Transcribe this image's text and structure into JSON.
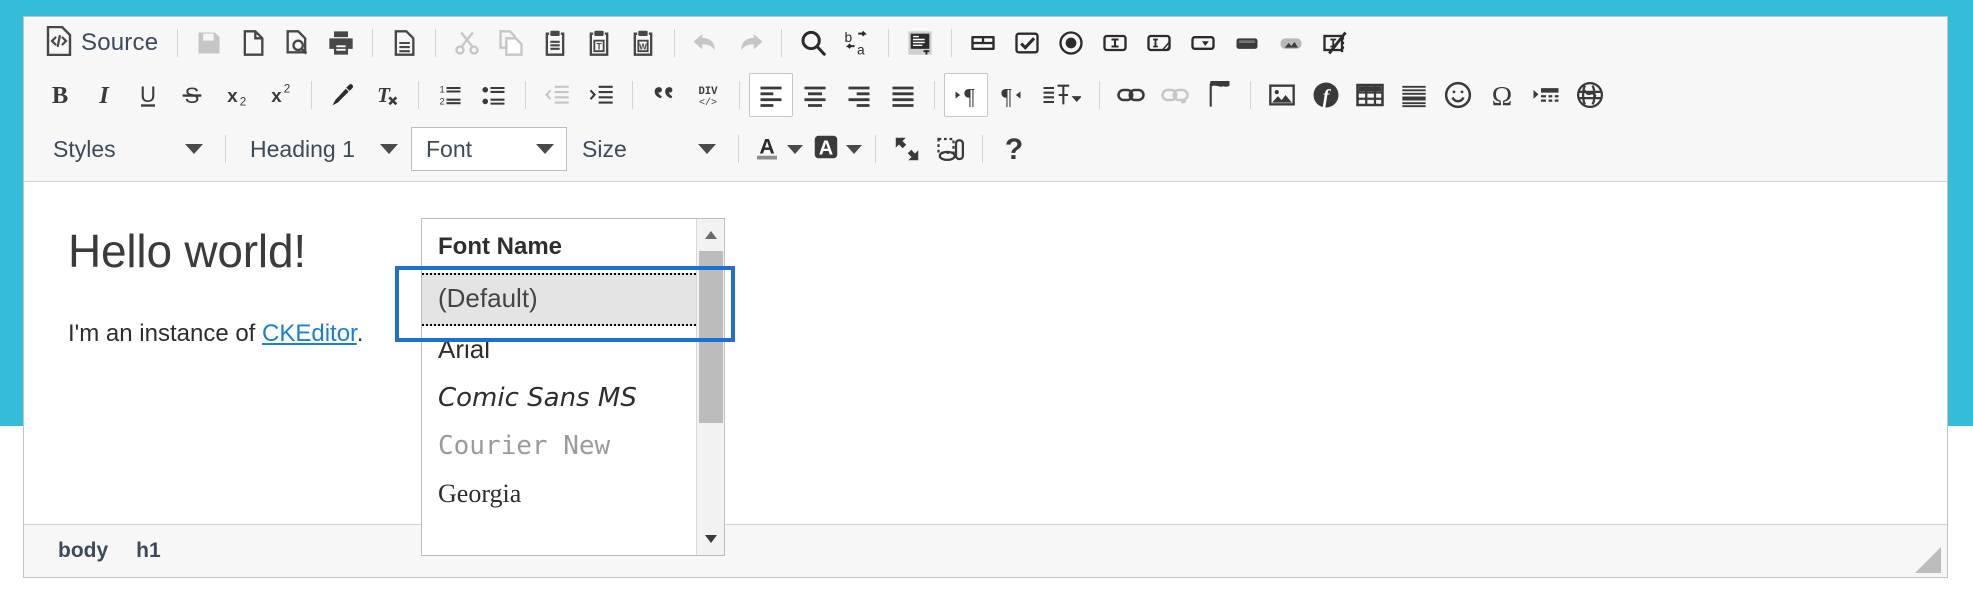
{
  "theme": {
    "page_background": "#35bcd8",
    "toolbar_background": "#f7f7f7",
    "accent_link": "#1d7fd0",
    "focus_ring": "#1f6fd0",
    "icon_color": "#474747",
    "icon_disabled": "#c6c6c6"
  },
  "toolbar": {
    "source_label": "Source",
    "row1": [
      {
        "name": "source-button",
        "label": "Source",
        "state": "enabled"
      },
      {
        "name": "separator",
        "label": "",
        "state": "separator"
      },
      {
        "name": "save-icon",
        "label": "Save",
        "state": "disabled"
      },
      {
        "name": "new-page-icon",
        "label": "New Page",
        "state": "enabled"
      },
      {
        "name": "preview-icon",
        "label": "Preview",
        "state": "enabled"
      },
      {
        "name": "print-icon",
        "label": "Print",
        "state": "enabled"
      },
      {
        "name": "separator",
        "label": "",
        "state": "separator"
      },
      {
        "name": "templates-icon",
        "label": "Templates",
        "state": "enabled"
      },
      {
        "name": "separator",
        "label": "",
        "state": "separator"
      },
      {
        "name": "cut-icon",
        "label": "Cut",
        "state": "disabled"
      },
      {
        "name": "copy-icon",
        "label": "Copy",
        "state": "disabled"
      },
      {
        "name": "paste-icon",
        "label": "Paste",
        "state": "enabled"
      },
      {
        "name": "paste-as-plain-text-icon",
        "label": "Paste as plain text",
        "state": "enabled"
      },
      {
        "name": "paste-from-word-icon",
        "label": "Paste from Word",
        "state": "enabled"
      },
      {
        "name": "separator",
        "label": "",
        "state": "separator"
      },
      {
        "name": "undo-icon",
        "label": "Undo",
        "state": "disabled"
      },
      {
        "name": "redo-icon",
        "label": "Redo",
        "state": "disabled"
      },
      {
        "name": "separator",
        "label": "",
        "state": "separator"
      },
      {
        "name": "find-icon",
        "label": "Find",
        "state": "enabled"
      },
      {
        "name": "replace-icon",
        "label": "Replace",
        "state": "enabled"
      },
      {
        "name": "separator",
        "label": "",
        "state": "separator"
      },
      {
        "name": "select-all-icon",
        "label": "Select All",
        "state": "enabled"
      },
      {
        "name": "separator",
        "label": "",
        "state": "separator"
      },
      {
        "name": "text-field-icon",
        "label": "Text Field",
        "state": "enabled"
      },
      {
        "name": "checkbox-icon",
        "label": "Checkbox",
        "state": "enabled"
      },
      {
        "name": "radio-button-icon",
        "label": "Radio Button",
        "state": "enabled"
      },
      {
        "name": "form-icon",
        "label": "Form",
        "state": "enabled"
      },
      {
        "name": "textarea-icon",
        "label": "Textarea",
        "state": "enabled"
      },
      {
        "name": "selection-field-icon",
        "label": "Selection Field",
        "state": "enabled"
      },
      {
        "name": "button-icon",
        "label": "Button",
        "state": "enabled"
      },
      {
        "name": "image-button-icon",
        "label": "Image Button",
        "state": "enabled"
      },
      {
        "name": "hidden-field-icon",
        "label": "Hidden Field",
        "state": "enabled"
      }
    ],
    "row2": [
      {
        "name": "bold-button",
        "label": "B",
        "state": "enabled"
      },
      {
        "name": "italic-button",
        "label": "I",
        "state": "enabled"
      },
      {
        "name": "underline-button",
        "label": "U",
        "state": "enabled"
      },
      {
        "name": "strikethrough-button",
        "label": "S",
        "state": "enabled"
      },
      {
        "name": "subscript-button",
        "label": "x2",
        "state": "enabled"
      },
      {
        "name": "superscript-button",
        "label": "x2",
        "state": "enabled"
      },
      {
        "name": "separator",
        "label": "",
        "state": "separator"
      },
      {
        "name": "copy-formatting-icon",
        "label": "Copy Formatting",
        "state": "enabled"
      },
      {
        "name": "remove-format-icon",
        "label": "Remove Format",
        "state": "enabled"
      },
      {
        "name": "separator",
        "label": "",
        "state": "separator"
      },
      {
        "name": "numbered-list-icon",
        "label": "Insert/Remove Numbered List",
        "state": "enabled"
      },
      {
        "name": "bulleted-list-icon",
        "label": "Insert/Remove Bulleted List",
        "state": "enabled"
      },
      {
        "name": "separator",
        "label": "",
        "state": "separator"
      },
      {
        "name": "decrease-indent-icon",
        "label": "Decrease Indent",
        "state": "disabled"
      },
      {
        "name": "increase-indent-icon",
        "label": "Increase Indent",
        "state": "enabled"
      },
      {
        "name": "separator",
        "label": "",
        "state": "separator"
      },
      {
        "name": "blockquote-icon",
        "label": "Block Quote",
        "state": "enabled"
      },
      {
        "name": "create-div-icon",
        "label": "Create Div Container",
        "state": "enabled"
      },
      {
        "name": "separator",
        "label": "",
        "state": "separator"
      },
      {
        "name": "align-left-icon",
        "label": "Align Left",
        "state": "active"
      },
      {
        "name": "align-center-icon",
        "label": "Center",
        "state": "enabled"
      },
      {
        "name": "align-right-icon",
        "label": "Align Right",
        "state": "enabled"
      },
      {
        "name": "justify-icon",
        "label": "Justify",
        "state": "enabled"
      },
      {
        "name": "separator",
        "label": "",
        "state": "separator"
      },
      {
        "name": "text-direction-ltr-icon",
        "label": "Text direction from left to right",
        "state": "active"
      },
      {
        "name": "text-direction-rtl-icon",
        "label": "Text direction from right to left",
        "state": "enabled"
      },
      {
        "name": "language-icon",
        "label": "Set language",
        "state": "enabled"
      },
      {
        "name": "separator",
        "label": "",
        "state": "separator"
      },
      {
        "name": "link-icon",
        "label": "Link",
        "state": "enabled"
      },
      {
        "name": "unlink-icon",
        "label": "Unlink",
        "state": "disabled"
      },
      {
        "name": "anchor-icon",
        "label": "Anchor",
        "state": "enabled"
      },
      {
        "name": "separator",
        "label": "",
        "state": "separator"
      },
      {
        "name": "image-icon",
        "label": "Image",
        "state": "enabled"
      },
      {
        "name": "flash-icon",
        "label": "Flash",
        "state": "enabled"
      },
      {
        "name": "table-icon",
        "label": "Table",
        "state": "enabled"
      },
      {
        "name": "horizontal-rule-icon",
        "label": "Insert Horizontal Line",
        "state": "enabled"
      },
      {
        "name": "smiley-icon",
        "label": "Smiley",
        "state": "enabled"
      },
      {
        "name": "special-character-icon",
        "label": "Insert Special Character",
        "state": "enabled"
      },
      {
        "name": "page-break-icon",
        "label": "Insert Page Break for Printing",
        "state": "enabled"
      },
      {
        "name": "iframe-icon",
        "label": "IFrame",
        "state": "enabled"
      }
    ],
    "styles_combo": {
      "label": "Styles",
      "state": "closed"
    },
    "format_combo": {
      "label": "Heading 1",
      "state": "closed"
    },
    "font_combo": {
      "label": "Font",
      "state": "open"
    },
    "size_combo": {
      "label": "Size",
      "state": "closed"
    },
    "row3_buttons": [
      {
        "name": "text-color-button",
        "label": "Text Color",
        "state": "enabled"
      },
      {
        "name": "background-color-button",
        "label": "Background Color",
        "state": "enabled"
      },
      {
        "name": "maximize-icon",
        "label": "Maximize",
        "state": "enabled"
      },
      {
        "name": "show-blocks-icon",
        "label": "Show Blocks",
        "state": "enabled"
      },
      {
        "name": "about-icon",
        "label": "About CKEditor",
        "state": "enabled"
      }
    ]
  },
  "font_panel": {
    "title": "Font Name",
    "items": [
      {
        "label": "(Default)",
        "selected": true,
        "style": "default"
      },
      {
        "label": "Arial",
        "selected": false,
        "style": "arial"
      },
      {
        "label": "Comic Sans MS",
        "selected": false,
        "style": "comic"
      },
      {
        "label": "Courier New",
        "selected": false,
        "style": "courier"
      },
      {
        "label": "Georgia",
        "selected": false,
        "style": "georgia"
      }
    ],
    "scroll_up_label": "Scroll up",
    "scroll_down_label": "Scroll down"
  },
  "content": {
    "heading": "Hello world!",
    "paragraph_before": "I'm an instance of ",
    "link_text": "CKEditor",
    "paragraph_after": "."
  },
  "statusbar": {
    "elements_path": [
      "body",
      "h1"
    ],
    "resize_label": "Resize"
  }
}
